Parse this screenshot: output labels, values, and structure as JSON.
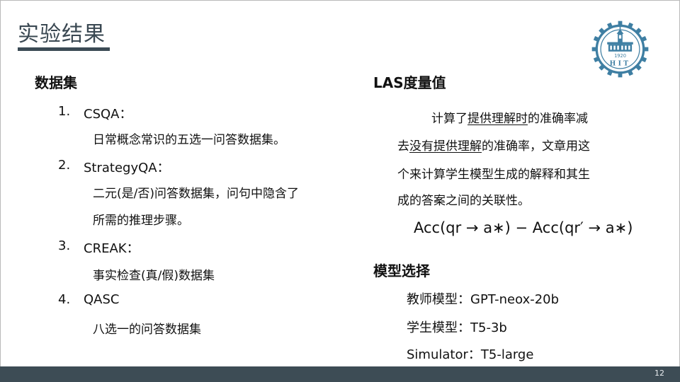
{
  "slide": {
    "title": "实验结果",
    "page_number": "12"
  },
  "logo": {
    "year": "1920",
    "letters": "HIT"
  },
  "datasets": {
    "heading": "数据集",
    "items": [
      {
        "num": "1.",
        "name": "CSQA：",
        "desc": [
          "日常概念常识的五选一问答数据集。"
        ]
      },
      {
        "num": "2.",
        "name": "StrategyQA：",
        "desc": [
          "二元(是/否)问答数据集，问句中隐含了",
          "所需的推理步骤。"
        ]
      },
      {
        "num": "3.",
        "name": "CREAK：",
        "desc": [
          "事实检查(真/假)数据集"
        ]
      },
      {
        "num": "4.",
        "name": "QASC",
        "desc": [
          "八选一的问答数据集"
        ]
      }
    ]
  },
  "las": {
    "heading": "LAS度量值",
    "line1": {
      "a": "计算了",
      "b": "提供理解时",
      "c": "的准确率减"
    },
    "line2": {
      "a": "去",
      "b": "没有提供理解",
      "c": "的准确率，文章用这"
    },
    "line3": "个来计算学生模型生成的解释和其生",
    "line4": "成的答案之间的关联性。",
    "formula": "Acc(qr → a∗) − Acc(qr′ → a∗)"
  },
  "models": {
    "heading": "模型选择",
    "teacher": "教师模型：GPT-neox-20b",
    "student": "学生模型：T5-3b",
    "simulator": "Simulator：T5-large"
  },
  "colors": {
    "title_text": "#3a4852",
    "accent_bar": "#3b4b55",
    "footer_bar": "#3d4c55",
    "logo_blue": "#3f7fa3"
  }
}
